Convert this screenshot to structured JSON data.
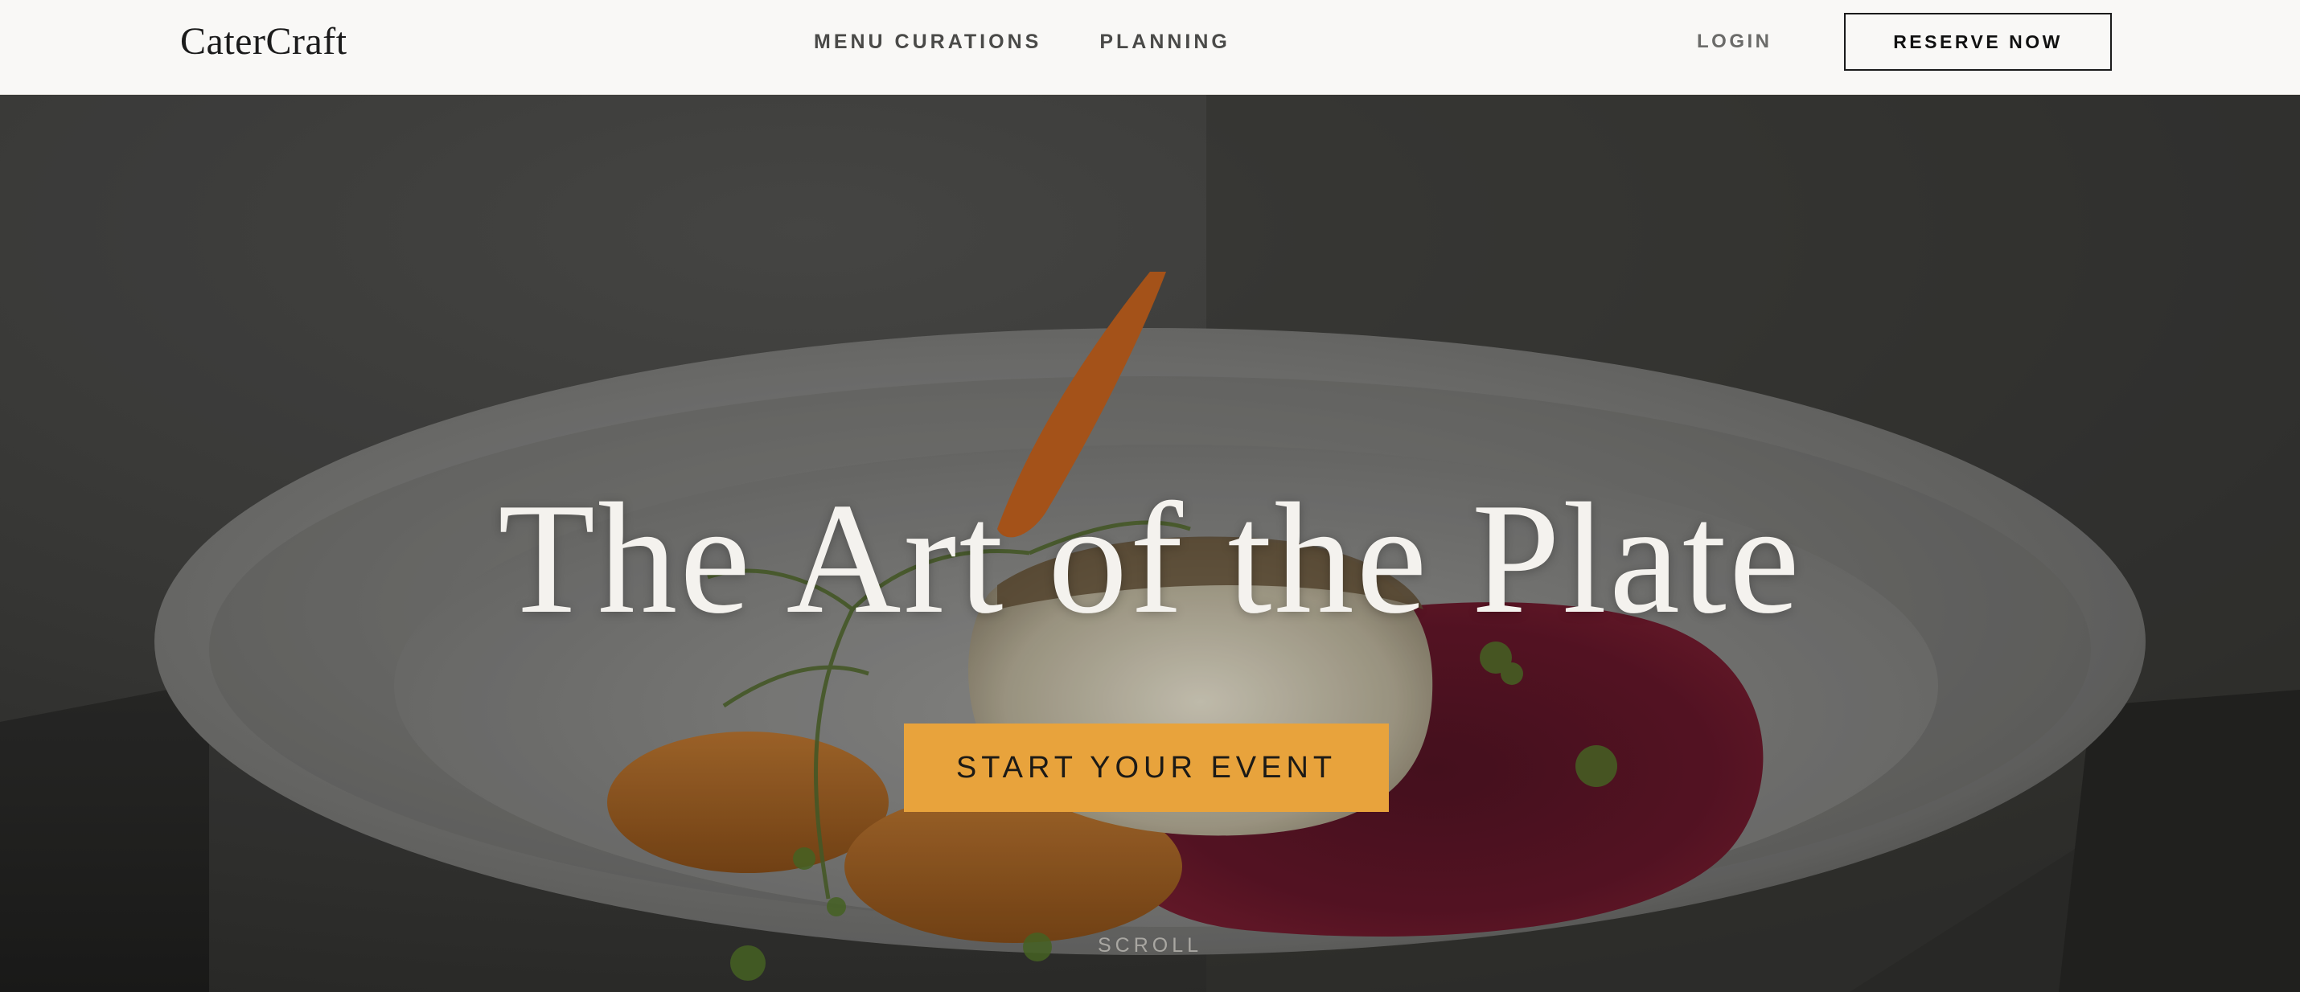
{
  "brand": {
    "name": "CaterCraft"
  },
  "nav": {
    "links": [
      {
        "label": "MENU CURATIONS"
      },
      {
        "label": "PLANNING"
      }
    ],
    "login_label": "LOGIN",
    "reserve_label": "RESERVE NOW"
  },
  "hero": {
    "title": "The Art of the Plate",
    "cta_label": "START YOUR EVENT",
    "scroll_label": "SCROLL",
    "image_icon": "plated-dish-photo"
  },
  "colors": {
    "accent": "#e8a33c",
    "nav_background": "#f9f8f6",
    "text_dark": "#1b1b1b",
    "hero_text": "#f4f2ee"
  }
}
